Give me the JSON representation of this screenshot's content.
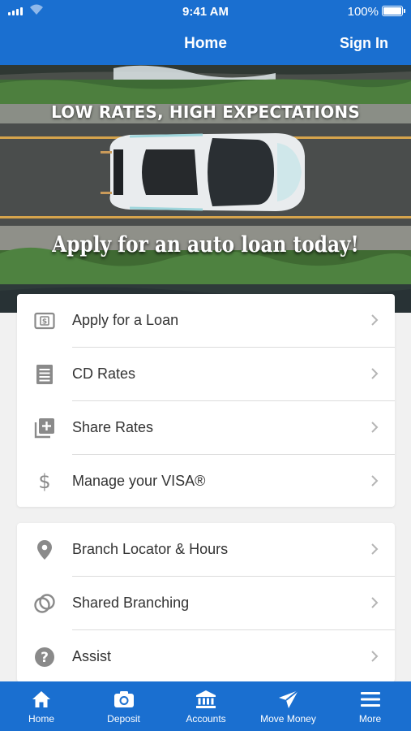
{
  "status_bar": {
    "time": "9:41 AM",
    "battery": "100%"
  },
  "nav": {
    "title": "Home",
    "sign_in": "Sign In"
  },
  "banner": {
    "headline": "LOW RATES, HIGH EXPECTATIONS",
    "cta": "Apply for an auto loan today!"
  },
  "menu_group_1": [
    {
      "label": "Apply for a Loan",
      "icon": "loan-icon"
    },
    {
      "label": "CD Rates",
      "icon": "document-list-icon"
    },
    {
      "label": "Share Rates",
      "icon": "add-library-icon"
    },
    {
      "label": "Manage your VISA®",
      "icon": "dollar-icon"
    }
  ],
  "menu_group_2": [
    {
      "label": "Branch Locator & Hours",
      "icon": "location-pin-icon"
    },
    {
      "label": "Shared Branching",
      "icon": "linked-rings-icon"
    },
    {
      "label": "Assist",
      "icon": "help-icon"
    }
  ],
  "tab_bar": [
    {
      "label": "Home",
      "icon": "home-icon"
    },
    {
      "label": "Deposit",
      "icon": "camera-icon"
    },
    {
      "label": "Accounts",
      "icon": "bank-icon"
    },
    {
      "label": "Move Money",
      "icon": "send-icon"
    },
    {
      "label": "More",
      "icon": "menu-icon"
    }
  ],
  "colors": {
    "brand_blue": "#1a6fd0",
    "icon_gray": "#8a8a8a"
  }
}
